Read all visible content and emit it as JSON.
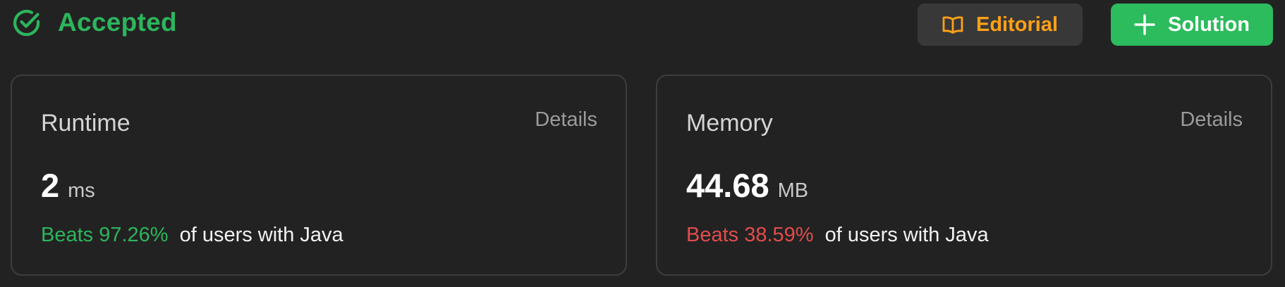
{
  "colors": {
    "accepted": "#2db55d",
    "editorial": "#ffa116",
    "solution_bg": "#2cbb5d",
    "beats_good": "#2db55d",
    "beats_bad": "#e14c4c"
  },
  "header": {
    "status": "Accepted",
    "status_icon": "check-circle-icon",
    "editorial_label": "Editorial",
    "editorial_icon": "book-open-icon",
    "solution_label": "Solution",
    "solution_icon": "plus-icon"
  },
  "runtime": {
    "title": "Runtime",
    "details_label": "Details",
    "value": "2",
    "unit": "ms",
    "beats": "Beats 97.26%",
    "suffix": "of users with Java"
  },
  "memory": {
    "title": "Memory",
    "details_label": "Details",
    "value": "44.68",
    "unit": "MB",
    "beats": "Beats 38.59%",
    "suffix": "of users with Java"
  }
}
